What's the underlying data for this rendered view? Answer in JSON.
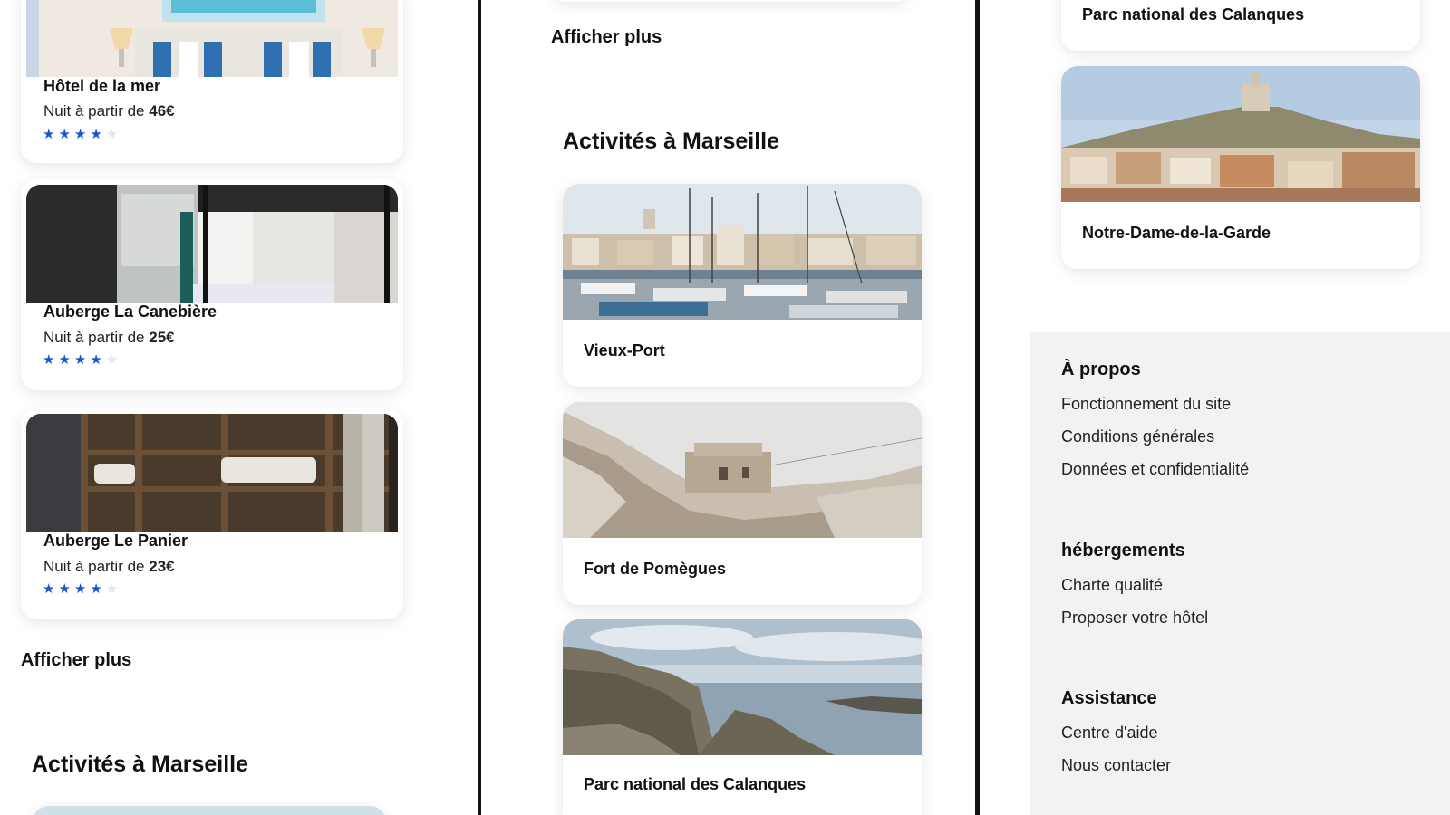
{
  "left": {
    "hotels": [
      {
        "name": "Hôtel de la mer",
        "price_prefix": "Nuit à partir de",
        "price": "46€",
        "rating": 4,
        "max_rating": 5
      },
      {
        "name": "Auberge La Canebière",
        "price_prefix": "Nuit à partir de",
        "price": "25€",
        "rating": 4,
        "max_rating": 5
      },
      {
        "name": "Auberge Le Panier",
        "price_prefix": "Nuit à partir de",
        "price": "23€",
        "rating": 4,
        "max_rating": 5
      }
    ],
    "show_more": "Afficher plus",
    "activities_title": "Activités à Marseille"
  },
  "middle": {
    "show_more": "Afficher plus",
    "activities_title": "Activités à Marseille",
    "activities": [
      {
        "name": "Vieux-Port"
      },
      {
        "name": "Fort de Pomègues"
      },
      {
        "name": "Parc national des Calanques"
      }
    ]
  },
  "right": {
    "activities": [
      {
        "name": "Parc national des Calanques"
      },
      {
        "name": "Notre-Dame-de-la-Garde"
      }
    ],
    "footer": {
      "sections": [
        {
          "title": "À propos",
          "links": [
            "Fonctionnement du site",
            "Conditions générales",
            "Données et confidentialité"
          ]
        },
        {
          "title": "hébergements",
          "links": [
            "Charte qualité",
            "Proposer votre hôtel"
          ]
        },
        {
          "title": "Assistance",
          "links": [
            "Centre d'aide",
            "Nous contacter"
          ]
        }
      ]
    }
  },
  "colors": {
    "star_active": "#1a56c9",
    "star_inactive": "#e6e6e6",
    "footer_bg": "#f2f2f2",
    "separator": "#111111"
  },
  "icons": {
    "star": "star-icon"
  }
}
